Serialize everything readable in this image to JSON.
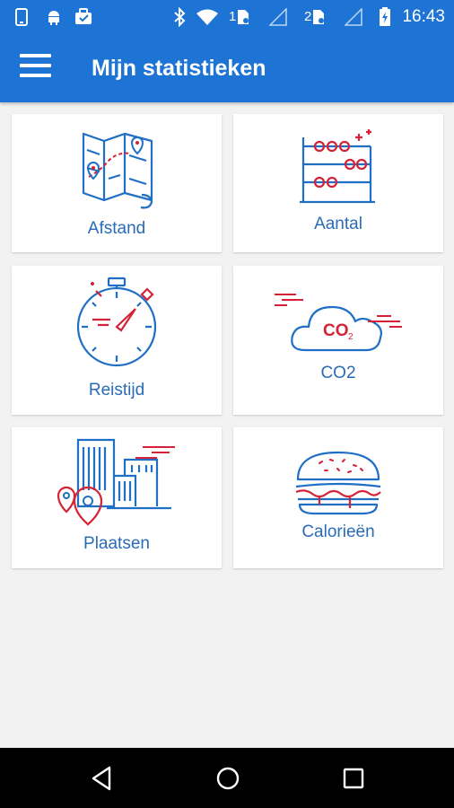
{
  "status_bar": {
    "time": "16:43",
    "sim1": "1",
    "sim2": "2",
    "icons": [
      "phone-notification-icon",
      "android-icon",
      "briefcase-icon",
      "bluetooth-icon",
      "wifi-icon",
      "sim1-icon",
      "signal-icon",
      "sim2-icon",
      "signal-icon",
      "battery-charging-icon"
    ]
  },
  "app_bar": {
    "title": "Mijn statistieken",
    "menu_icon": "hamburger-menu-icon"
  },
  "tiles": [
    {
      "label": "Afstand",
      "icon": "map-route-icon"
    },
    {
      "label": "Aantal",
      "icon": "abacus-icon"
    },
    {
      "label": "Reistijd",
      "icon": "stopwatch-icon"
    },
    {
      "label": "CO2",
      "icon": "co2-cloud-icon",
      "icon_text": "CO",
      "icon_sub": "2"
    },
    {
      "label": "Plaatsen",
      "icon": "city-location-icon"
    },
    {
      "label": "Calorieën",
      "icon": "burger-icon"
    }
  ],
  "nav_bar": {
    "buttons": [
      "back-icon",
      "home-icon",
      "recents-icon"
    ]
  },
  "colors": {
    "primary": "#1d74d4",
    "icon_blue": "#1f6fc5",
    "icon_red": "#d62236",
    "label": "#2a6bb8",
    "background": "#f2f2f2"
  }
}
